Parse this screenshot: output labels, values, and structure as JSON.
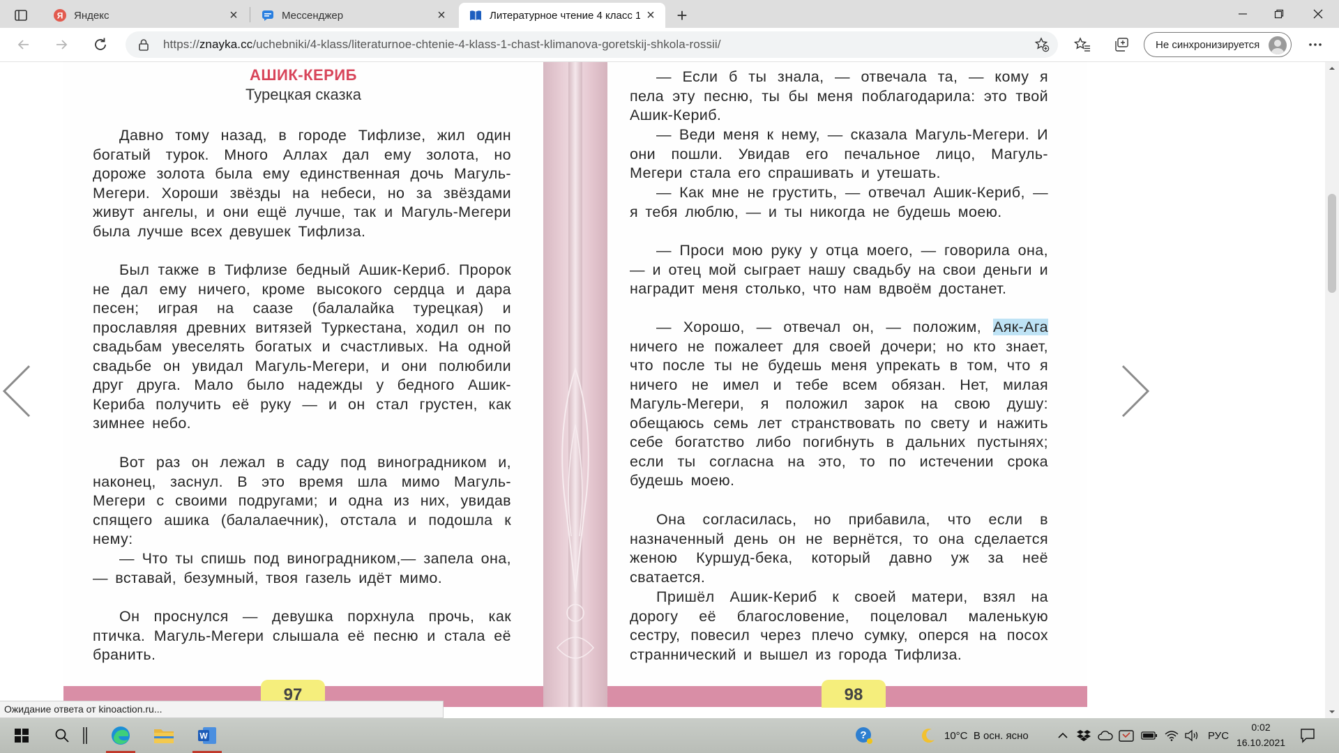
{
  "browser": {
    "tabs": [
      {
        "label": "Яндекс",
        "icon": "yandex-icon"
      },
      {
        "label": "Мессенджер",
        "icon": "messenger-icon"
      },
      {
        "label": "Литературное чтение 4 класс 1",
        "icon": "znayka-icon",
        "active": true
      }
    ],
    "new_tab_symbol": "+",
    "close_symbol": "×",
    "url": {
      "scheme": "https://",
      "host": "znayka.cc",
      "path": "/uchebniki/4-klass/literaturnoe-chtenie-4-klass-1-chast-klimanova-goretskij-shkola-rossii/"
    },
    "sync_label": "Не синхронизируется",
    "status_text": "Ожидание ответа от kinoaction.ru..."
  },
  "book": {
    "left_page": {
      "title": "АШИК-КЕРИБ",
      "subtitle": "Турецкая сказка",
      "page_number": "97",
      "paragraphs": [
        "Давно тому назад, в городе Тифлизе, жил один богатый турок. Много Аллах дал ему золота, но дороже золота была ему единственная дочь Магуль-Мегери. Хороши звёзды на небеси, но за звёздами живут ангелы, и они ещё лучше, так и Магуль-Мегери была лучше всех девушек Тифлиза.",
        "Был также в Тифлизе бедный Ашик-Кериб. Пророк не дал ему ничего, кроме высокого сердца и дара песен; играя на саазе (балалайка турецкая) и прославляя древних витязей Туркестана, ходил он по свадьбам увеселять богатых и счастливых. На одной свадьбе он увидал Магуль-Мегери, и они полюбили друг друга. Мало было надежды у бедного Ашик-Кериба получить её руку — и он стал грустен, как зимнее небо.",
        "Вот раз он лежал в саду под виноградником и, наконец, заснул. В это время шла мимо Магуль-Мегери с своими подругами; и одна из них, увидав спящего ашика (балалаечник), отстала и подошла к нему:",
        "— Что ты спишь под виноградником,— запела она,— вставай, безумный, твоя газель идёт мимо.",
        "Он проснулся — девушка порхнула прочь, как птичка. Магуль-Мегери слышала её песню и стала её бранить."
      ]
    },
    "right_page": {
      "page_number": "98",
      "paragraphs": [
        "— Если б ты знала, — отвечала та, — кому я пела эту песню, ты бы меня поблагодарила: это твой Ашик-Кериб.",
        "— Веди меня к нему, — сказала Магуль-Мегери. И они пошли. Увидав его печальное лицо, Магуль-Мегери стала его спрашивать и утешать.",
        "— Как мне не грустить, — отвечал Ашик-Кериб, — я тебя люблю, — и ты никогда не будешь моею.",
        "— Проси мою руку у отца моего, — говорила она, — и отец мой сыграет нашу свадьбу на свои деньги и наградит меня столько, что нам вдвоём достанет.",
        "— Хорошо, — отвечал он, — положим, ",
        "Аяк-Ага",
        " ничего не пожалеет для своей дочери; но кто знает, что после ты не будешь меня упрекать в том, что я ничего не имел и тебе всем обязан. Нет, милая Магуль-Мегери, я положил зарок на свою душу: обещаюсь семь лет странствовать по свету и нажить себе богатство либо погибнуть в дальних пустынях; если ты согласна на это, то по истечении срока будешь моею.",
        "Она согласилась, но прибавила, что если в назначенный день он не вернётся, то она сделается женою Куршуд-бека, который давно уж за неё сватается.",
        "Пришёл Ашик-Кериб к своей матери, взял на дорогу её благословение, поцеловал маленькую сестру, повесил через плечо сумку, оперся на посох страннический и вышел из города Тифлиза."
      ]
    }
  },
  "taskbar": {
    "weather": "10°C  В осн. ясно",
    "language": "РУС",
    "time": "0:02",
    "date": "16.10.2021"
  },
  "colors": {
    "title_red": "#d8455a",
    "page_band": "#d98ea6",
    "page_number_bg": "#f5ee7c",
    "highlight": "#bfe3f5"
  }
}
